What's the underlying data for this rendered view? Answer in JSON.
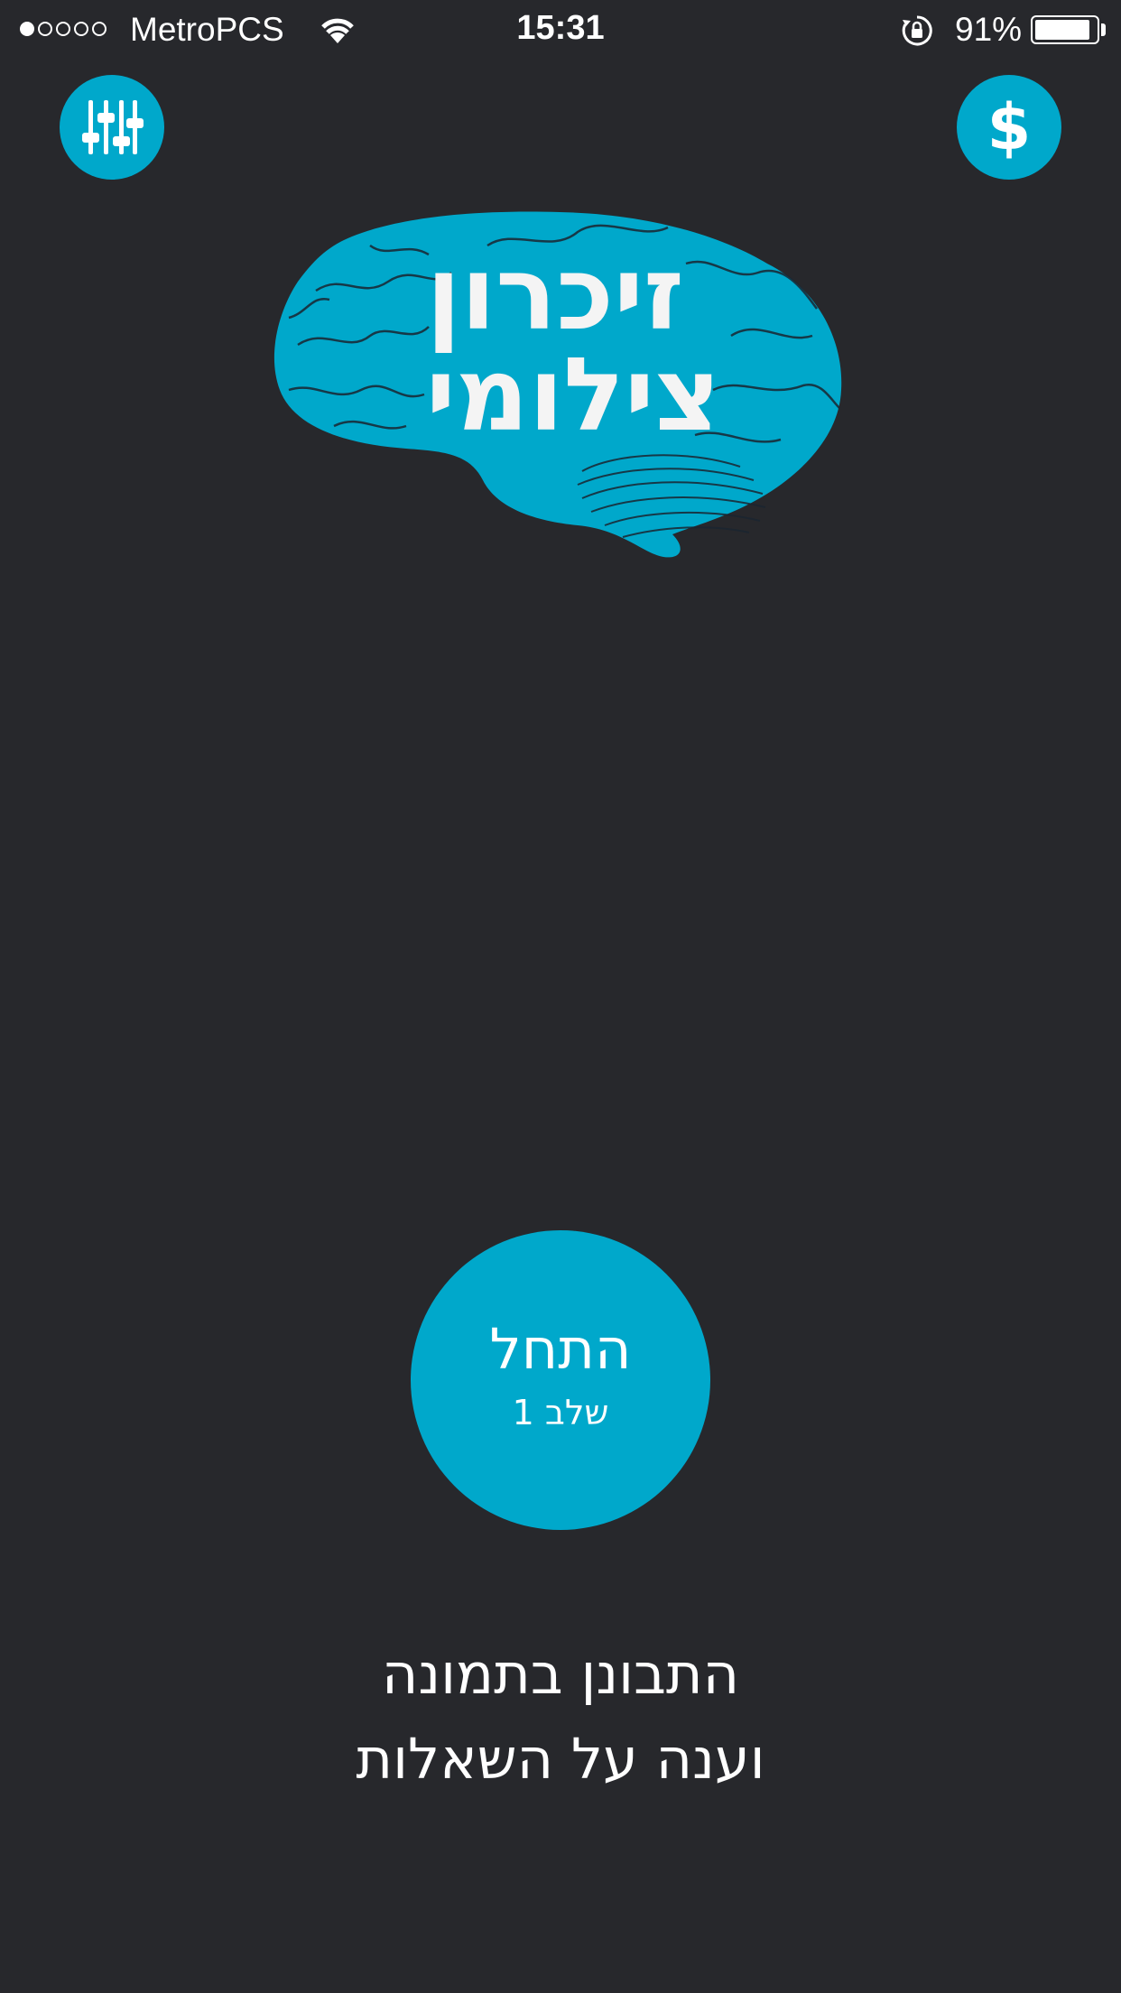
{
  "status_bar": {
    "carrier": "MetroPCS",
    "time": "15:31",
    "battery_percent": "91%",
    "signal_bars": 1,
    "signal_total": 5,
    "battery_level": 0.91
  },
  "toolbar": {
    "settings_icon": "sliders-icon",
    "purchase_icon": "dollar-icon",
    "purchase_symbol": "$"
  },
  "logo": {
    "line1": "זיכרון",
    "line2": "צילומי"
  },
  "start": {
    "label": "התחל",
    "level": "שלב 1"
  },
  "instruction": {
    "line1": "התבונן בתמונה",
    "line2": "וענה על השאלות"
  },
  "colors": {
    "background": "#27282c",
    "accent": "#00a8cb",
    "text": "#ffffff"
  }
}
